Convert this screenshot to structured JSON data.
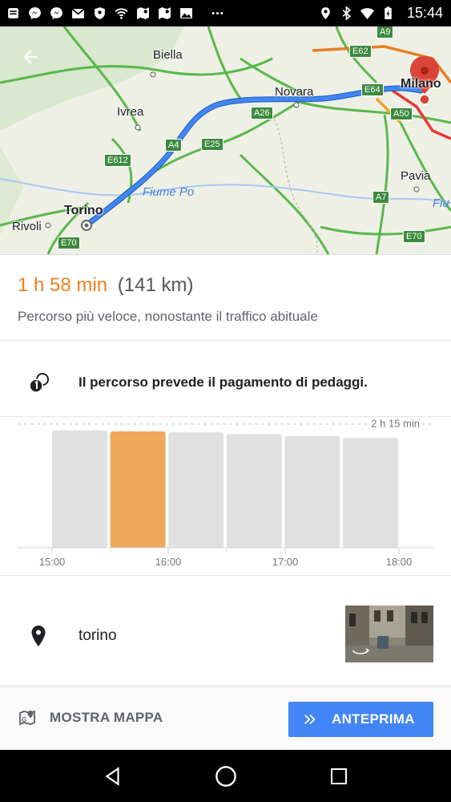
{
  "status_bar": {
    "time": "15:44",
    "icons": [
      "sim-icon",
      "messenger-icon",
      "messenger-icon",
      "gmail-icon",
      "shield-icon",
      "wifi-icon",
      "maps-icon",
      "maps-icon",
      "image-icon",
      "more-icon",
      "location-icon",
      "bluetooth-icon",
      "wifi-signal-icon",
      "battery-charging-icon"
    ]
  },
  "map": {
    "cities": {
      "biella": "Biella",
      "novara": "Novara",
      "milano": "Milano",
      "ivrea": "Ivrea",
      "torino": "Torino",
      "rivoli": "Rivoli",
      "pavia": "Pavia"
    },
    "river": "Fiume Po",
    "river2": "Fiu",
    "roads": {
      "a9": "A9",
      "e62": "E62",
      "e64": "E64",
      "a26": "A26",
      "a50": "A50",
      "a4": "A4",
      "e25": "E25",
      "e612": "E612",
      "a7": "A7",
      "e70a": "E70",
      "e70b": "E70"
    },
    "route_color": "#4285f4"
  },
  "summary": {
    "duration": "1 h 58 min",
    "distance": "(141 km)",
    "description": "Percorso più veloce, nonostante il traffico abituale"
  },
  "toll": {
    "text": "Il percorso prevede il pagamento di pedaggi."
  },
  "chart_data": {
    "type": "bar",
    "title": "",
    "reference_label": "2 h 15 min",
    "reference_value": 135,
    "ylim": [
      0,
      140
    ],
    "x_ticks": [
      "15:00",
      "16:00",
      "17:00",
      "18:00"
    ],
    "values": [
      128,
      127,
      126,
      124,
      122,
      120
    ],
    "selected_index": 1,
    "bar_color": "#e0e0e0",
    "selected_color": "#f0a85c"
  },
  "destination": {
    "name": "torino"
  },
  "actions": {
    "show_map": "MOSTRA MAPPA",
    "preview": "ANTEPRIMA"
  }
}
